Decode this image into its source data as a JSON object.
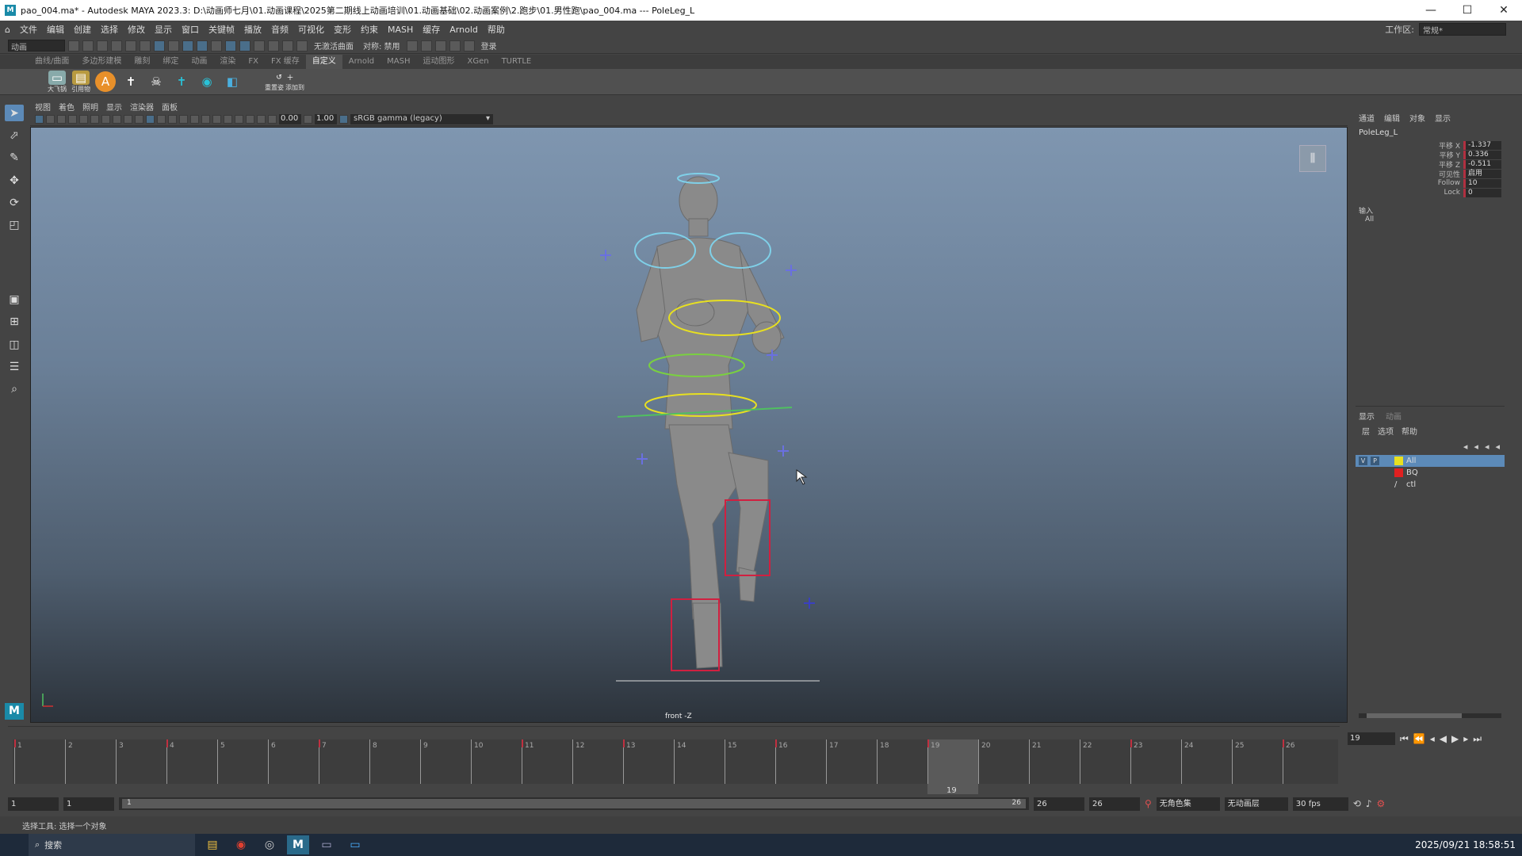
{
  "titlebar": {
    "app_icon": "M",
    "title": "pao_004.ma* - Autodesk MAYA 2023.3: D:\\动画师七月\\01.动画课程\\2025第二期线上动画培训\\01.动画基础\\02.动画案例\\2.跑步\\01.男性跑\\pao_004.ma  ---  PoleLeg_L",
    "min": "—",
    "max": "☐",
    "close": "✕"
  },
  "menus": [
    "文件",
    "编辑",
    "创建",
    "选择",
    "修改",
    "显示",
    "窗口",
    "关键帧",
    "播放",
    "音频",
    "可视化",
    "变形",
    "约束",
    "MASH",
    "缓存",
    "Arnold",
    "帮助"
  ],
  "workspace": {
    "label": "工作区:",
    "value": "常规*"
  },
  "statusline": {
    "mode": "动画",
    "snap_label": "无激活曲面",
    "symmetry": "对称: 禁用",
    "login": "登录"
  },
  "shelf_tabs": [
    "曲线/曲面",
    "多边形建模",
    "雕刻",
    "绑定",
    "动画",
    "渲染",
    "FX",
    "FX 缓存",
    "自定义",
    "Arnold",
    "MASH",
    "运动图形",
    "XGen",
    "TURTLE"
  ],
  "shelf_active": "自定义",
  "shelf": {
    "cap1": "大飞锅",
    "cap2": "引用物",
    "cap3": "重置姿",
    "cap4": "添加到"
  },
  "panel_menus": [
    "视图",
    "着色",
    "照明",
    "显示",
    "渲染器",
    "面板"
  ],
  "panel_toolbar": {
    "val1": "0.00",
    "val2": "1.00",
    "colorspace": "sRGB gamma (legacy)"
  },
  "viewport": {
    "camera": "front -Z"
  },
  "channelbox": {
    "tabs": [
      "通道",
      "编辑",
      "对象",
      "显示"
    ],
    "node": "PoleLeg_L",
    "attrs": [
      {
        "name": "平移 X",
        "value": "-1.337"
      },
      {
        "name": "平移 Y",
        "value": "0.336"
      },
      {
        "name": "平移 Z",
        "value": "-0.511"
      },
      {
        "name": "可见性",
        "value": "启用"
      },
      {
        "name": "Follow",
        "value": "10"
      },
      {
        "name": "Lock",
        "value": "0"
      }
    ],
    "inputs_label": "输入",
    "inputs_item": "All"
  },
  "layers": {
    "tabs": [
      "显示",
      "动画"
    ],
    "menus": [
      "层",
      "选项",
      "帮助"
    ],
    "rows": [
      {
        "name": "All",
        "color": "#e8e020",
        "v": "V",
        "p": "P",
        "selected": true
      },
      {
        "name": "BQ",
        "color": "#e02020",
        "v": "",
        "p": "",
        "selected": false
      },
      {
        "name": "ctl",
        "color": "",
        "v": "",
        "p": "",
        "selected": false
      }
    ]
  },
  "timeline": {
    "frames": [
      "1",
      "2",
      "3",
      "4",
      "5",
      "6",
      "7",
      "8",
      "9",
      "10",
      "11",
      "12",
      "13",
      "14",
      "15",
      "16",
      "17",
      "18",
      "19",
      "20",
      "21",
      "22",
      "23",
      "24",
      "25",
      "26"
    ],
    "current": "19",
    "keys": [
      "1",
      "4",
      "7",
      "11",
      "13",
      "16",
      "19",
      "23",
      "26"
    ]
  },
  "playback": {
    "current_frame": "19"
  },
  "range": {
    "start": "1",
    "anim_start": "1",
    "range_start": "1",
    "range_end": "26",
    "anim_end": "26",
    "end": "26",
    "charset": "无角色集",
    "animlayer": "无动画层",
    "fps": "30 fps"
  },
  "helpline": {
    "text": "选择工具: 选择一个对象"
  },
  "taskbar": {
    "search": "搜索",
    "datetime": "2025/09/21 18:58:51"
  }
}
